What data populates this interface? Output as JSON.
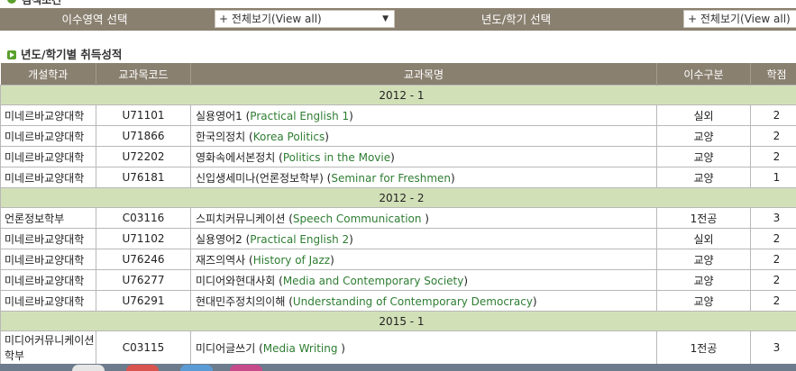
{
  "top_section": {
    "label": "검색조건"
  },
  "filters": {
    "area_label": "이수영역 선택",
    "area_value": "+ 전체보기(View all)",
    "term_label": "년도/학기 선택",
    "term_value": "+ 전체보기(View all)"
  },
  "section_title": "년도/학기별 취득성적",
  "table": {
    "headers": [
      "개설학과",
      "교과목코드",
      "교과목명",
      "이수구분",
      "학점"
    ],
    "groups": [
      {
        "semester": "2012 - 1",
        "rows": [
          {
            "dept": "미네르바교양대학",
            "code": "U71101",
            "name_ko": "실용영어1",
            "name_en": "Practical English 1",
            "type": "실외",
            "credit": "2"
          },
          {
            "dept": "미네르바교양대학",
            "code": "U71866",
            "name_ko": "한국의정치",
            "name_en": "Korea Politics",
            "type": "교양",
            "credit": "2"
          },
          {
            "dept": "미네르바교양대학",
            "code": "U72202",
            "name_ko": "영화속에서본정치",
            "name_en": "Politics in the Movie",
            "type": "교양",
            "credit": "2"
          },
          {
            "dept": "미네르바교양대학",
            "code": "U76181",
            "name_ko": "신입생세미나(언론정보학부)",
            "name_en": "Seminar for Freshmen",
            "type": "교양",
            "credit": "1"
          }
        ]
      },
      {
        "semester": "2012 - 2",
        "rows": [
          {
            "dept": "언론정보학부",
            "code": "C03116",
            "name_ko": "스피치커뮤니케이션",
            "name_en": "Speech Communication ",
            "type": "1전공",
            "credit": "3"
          },
          {
            "dept": "미네르바교양대학",
            "code": "U71102",
            "name_ko": "실용영어2",
            "name_en": "Practical English 2",
            "type": "실외",
            "credit": "2"
          },
          {
            "dept": "미네르바교양대학",
            "code": "U76246",
            "name_ko": "재즈의역사",
            "name_en": "History of Jazz",
            "type": "교양",
            "credit": "2"
          },
          {
            "dept": "미네르바교양대학",
            "code": "U76277",
            "name_ko": "미디어와현대사회",
            "name_en": "Media and Contemporary Society",
            "type": "교양",
            "credit": "2"
          },
          {
            "dept": "미네르바교양대학",
            "code": "U76291",
            "name_ko": "현대민주정치의이해",
            "name_en": "Understanding of Contemporary Democracy",
            "type": "교양",
            "credit": "2"
          }
        ]
      },
      {
        "semester": "2015 - 1",
        "rows": [
          {
            "dept": "미디어커뮤니케이션학부",
            "code": "C03115",
            "name_ko": "미디어글쓰기",
            "name_en": "Media Writing ",
            "type": "1전공",
            "credit": "3"
          }
        ]
      }
    ]
  },
  "colors": {
    "header_bg": "#8a8070",
    "semester_bg": "#d2e0b8",
    "english_text": "#2e7d32"
  }
}
